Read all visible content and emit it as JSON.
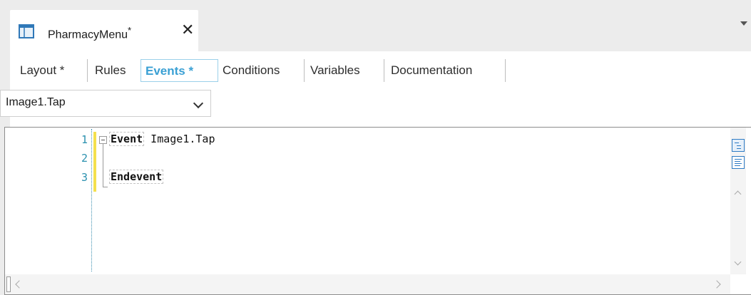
{
  "document_tab": {
    "title": "PharmacyMenu",
    "modified_marker": "*",
    "close_glyph": "✕",
    "icon": "panel-layout-icon"
  },
  "part_tabs": [
    {
      "label": "Layout *"
    },
    {
      "label": "Rules"
    },
    {
      "label": "Events *"
    },
    {
      "label": "Conditions"
    },
    {
      "label": "Variables"
    },
    {
      "label": "Documentation"
    }
  ],
  "active_tab": "Events *",
  "event_combo": {
    "value": "Image1.Tap"
  },
  "editor": {
    "lines": [
      {
        "number": "1",
        "keyword": "Event",
        "rest": " Image1.Tap"
      },
      {
        "number": "2",
        "keyword": "",
        "rest": ""
      },
      {
        "number": "3",
        "keyword": "Endevent",
        "rest": ""
      }
    ]
  },
  "colors": {
    "active_tab": "#3aa0d4",
    "line_numbers": "#2b91af",
    "change_bar": "#f4e04d"
  }
}
